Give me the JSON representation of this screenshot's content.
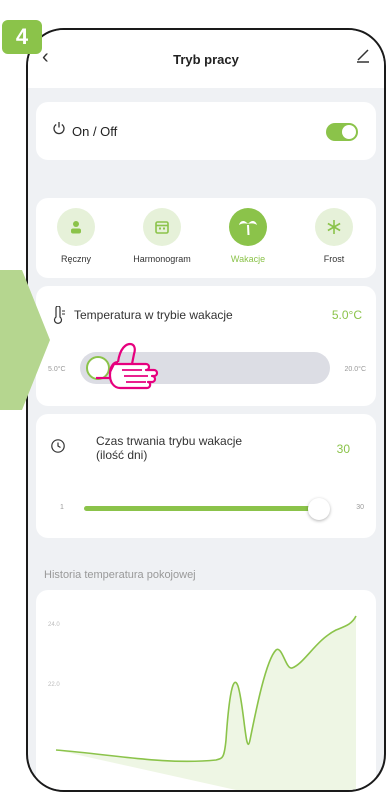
{
  "step_number": "4",
  "header": {
    "title": "Tryb pracy"
  },
  "power": {
    "label": "On / Off",
    "enabled": true
  },
  "modes": [
    {
      "label": "Ręczny",
      "icon": "person-icon",
      "active": false
    },
    {
      "label": "Harmonogram",
      "icon": "calendar-icon",
      "active": false
    },
    {
      "label": "Wakacje",
      "icon": "palm-tree-icon",
      "active": true
    },
    {
      "label": "Frost",
      "icon": "snowflake-icon",
      "active": false
    }
  ],
  "temperature": {
    "label": "Temperatura w trybie wakacje",
    "value": "5.0°C",
    "min": "5.0°C",
    "max": "20.0°C",
    "level": 0
  },
  "duration": {
    "label_line1": "Czas trwania trybu wakacje",
    "label_line2": "(ilość dni)",
    "value": "30",
    "min": "1",
    "max": "30",
    "level": 1
  },
  "history": {
    "title": "Historia temperatura pokojowej",
    "y_labels": [
      "24.0",
      "22.0"
    ]
  },
  "colors": {
    "accent": "#8bc34a",
    "pointer_hand": "#e6007e"
  }
}
